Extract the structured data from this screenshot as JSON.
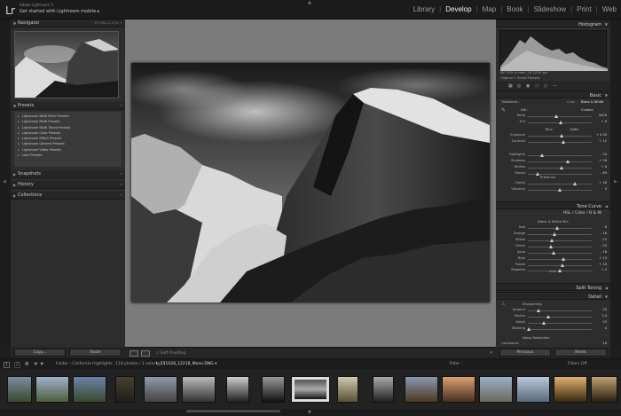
{
  "app": {
    "logo": "Lr",
    "name": "Adobe Lightroom 5",
    "task": "Get started with Lightroom mobile ▸"
  },
  "modules": [
    "Library",
    "Develop",
    "Map",
    "Book",
    "Slideshow",
    "Print",
    "Web"
  ],
  "active_module": "Develop",
  "left": {
    "navigator": {
      "title": "Navigator",
      "opts": "FIT   FILL   1:1   3:1 ÷"
    },
    "presets": {
      "title": "Presets",
      "items": [
        "Lightroom B&W Filter Presets",
        "Lightroom B&W Presets",
        "Lightroom B&W Toned Presets",
        "Lightroom Color Presets",
        "Lightroom Effect Presets",
        "Lightroom General Presets",
        "Lightroom Video Presets",
        "User Presets"
      ]
    },
    "snapshots": "Snapshots",
    "history": "History",
    "collections": "Collections",
    "copy_label": "Copy...",
    "paste_label": "Paste"
  },
  "toolbar": {
    "soft_proofing": "Soft Proofing"
  },
  "right": {
    "histogram_title": "Histogram",
    "histo_info": "ISO 100     14 mm     f / 8     1/125 sec",
    "original_label": "Original + Smart Preview",
    "basic": {
      "title": "Basic",
      "treatment_label": "Treatment :",
      "color_label": "Color",
      "bw_label": "Black & White",
      "wb_label": "WB :",
      "wb_value": "Custom",
      "tone_label": "Tone",
      "auto_label": "Auto",
      "presence_label": "Presence",
      "sliders": [
        {
          "label": "Temp",
          "value": "4428"
        },
        {
          "label": "Tint",
          "value": "+ 6"
        },
        {
          "label": "Exposure",
          "value": "+ 0.30"
        },
        {
          "label": "Contrast",
          "value": "+ 12"
        },
        {
          "label": "Highlights",
          "value": "- 54"
        },
        {
          "label": "Shadows",
          "value": "+ 26"
        },
        {
          "label": "Whites",
          "value": "+ 8"
        },
        {
          "label": "Blacks",
          "value": "- 69"
        },
        {
          "label": "Clarity",
          "value": "+ 48"
        },
        {
          "label": "Vibrance",
          "value": "0"
        }
      ]
    },
    "tone_curve": "Tone Curve",
    "hsl_tabs": "HSL  /  Color  /  B & W",
    "bw_mix": {
      "title": "Black & White Mix",
      "sliders": [
        {
          "label": "Red",
          "value": "- 6"
        },
        {
          "label": "Orange",
          "value": "- 16"
        },
        {
          "label": "Yellow",
          "value": "- 23"
        },
        {
          "label": "Green",
          "value": "- 25"
        },
        {
          "label": "Aqua",
          "value": "- 18"
        },
        {
          "label": "Blue",
          "value": "+ 13"
        },
        {
          "label": "Purple",
          "value": "+ 10"
        },
        {
          "label": "Magenta",
          "value": "+ 2"
        }
      ],
      "auto_label": "Auto"
    },
    "split_toning": "Split Toning",
    "detail": {
      "title": "Detail",
      "sharpening_label": "Sharpening",
      "sliders": [
        {
          "label": "Amount",
          "value": "25"
        },
        {
          "label": "Radius",
          "value": "1.0"
        },
        {
          "label": "Detail",
          "value": "25"
        },
        {
          "label": "Masking",
          "value": "0"
        }
      ],
      "noise_label": "Noise Reduction",
      "luminance_label": "Luminance",
      "luminance_value": "10"
    },
    "previous_label": "Previous",
    "reset_label": "Reset"
  },
  "filmbar": {
    "pages": [
      "1",
      "2"
    ],
    "folder": "Folder : California Highlights",
    "count": "114 photos / 1 selected /",
    "filename": "L_151028_12218_Mono.DNG ▾",
    "filter_label": "Filter :",
    "filters_off": "Filters Off"
  }
}
